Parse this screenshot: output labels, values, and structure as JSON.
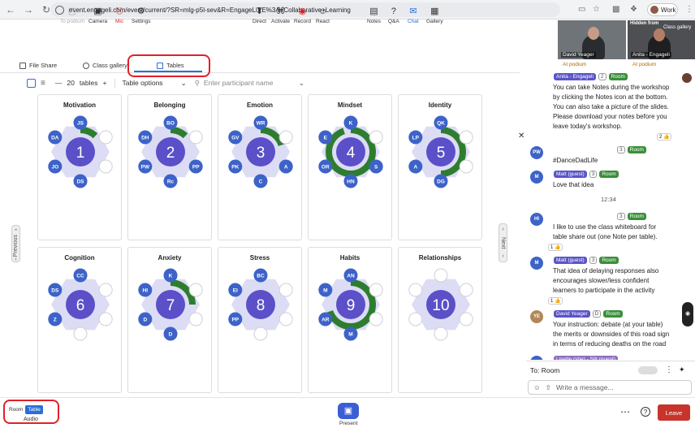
{
  "browser": {
    "url": "event.engageli.com/event/current/?SR=mlg-p5l-sev&R=EngageLIVE%3A+Collaborative+Learning",
    "profile": "Work"
  },
  "videos": [
    {
      "name": "David Yeager",
      "status": "At podium"
    },
    {
      "name": "Anita - Engageli",
      "status": "At podium",
      "overlay_left": "Hidden from",
      "overlay_right": "Class gallery"
    }
  ],
  "tabs": {
    "file_share": "File Share",
    "class_gallery": "Class gallery",
    "tables": "Tables"
  },
  "toolbar": {
    "count": "20",
    "count_label": "tables",
    "minus": "—",
    "plus": "+",
    "options": "Table options",
    "search_placeholder": "Enter participant name"
  },
  "tables": [
    {
      "title": "Motivation",
      "number": "1",
      "fill": 0.12,
      "seats": [
        "JS",
        "",
        "",
        "DS",
        "JO",
        "DA"
      ]
    },
    {
      "title": "Belonging",
      "number": "2",
      "fill": 0.12,
      "seats": [
        "BO",
        "",
        "PP",
        "Rc",
        "PW",
        "DH"
      ]
    },
    {
      "title": "Emotion",
      "number": "3",
      "fill": 0.2,
      "seats": [
        "WR",
        "",
        "A",
        "C",
        "PK",
        "GV"
      ]
    },
    {
      "title": "Mindset",
      "number": "4",
      "fill": 0.95,
      "seats": [
        "K",
        "",
        "S",
        "HN",
        "OR",
        "E"
      ]
    },
    {
      "title": "Identity",
      "number": "5",
      "fill": 0.5,
      "seats": [
        "QK",
        "",
        "",
        "DG",
        "A",
        "LP"
      ]
    },
    {
      "title": "Cognition",
      "number": "6",
      "fill": 0,
      "seats": [
        "CC",
        "",
        "",
        "",
        "Z",
        "DS"
      ]
    },
    {
      "title": "Anxiety",
      "number": "7",
      "fill": 0.25,
      "seats": [
        "K",
        "",
        "",
        "D",
        "D",
        "HI"
      ]
    },
    {
      "title": "Stress",
      "number": "8",
      "fill": 0,
      "seats": [
        "BC",
        "",
        "",
        "",
        "PP",
        "EI"
      ]
    },
    {
      "title": "Habits",
      "number": "9",
      "fill": 0.7,
      "seats": [
        "AN",
        "",
        "",
        "M",
        "AR",
        "M"
      ]
    },
    {
      "title": "Relationships",
      "number": "10",
      "fill": 0,
      "seats": [
        "",
        "",
        "",
        "",
        "",
        ""
      ]
    }
  ],
  "nav": {
    "previous": "Previous",
    "next": "Next"
  },
  "chat": {
    "messages": [
      {
        "initials": "",
        "author": "Anita - Engageli",
        "badge": "2",
        "room": "Room",
        "text": [
          "You can take Notes during the workshop",
          "by clicking the Notes icon at the bottom.",
          "You can also take a picture of the slides.",
          "Please download your notes before you",
          "leave today's workshop."
        ],
        "reaction": "2 👍"
      },
      {
        "initials": "PW",
        "author": "",
        "badge": "3",
        "room": "Room",
        "text": [
          "#DanceDadLife"
        ],
        "reaction": ""
      },
      {
        "initials": "M",
        "author": "Matt (guest)",
        "badge": "3",
        "room": "Room",
        "text": [
          "Love that idea"
        ],
        "reaction": ""
      },
      {
        "initials": "HI",
        "author": "",
        "badge": "3",
        "room": "Room",
        "text": [
          "I like to use the class whiteboard for",
          "table share out (one Note per table)."
        ],
        "reaction": "1 👍"
      },
      {
        "initials": "M",
        "author": "Matt (guest)",
        "badge": "3",
        "room": "Room",
        "text": [
          "That idea of delaying responses also",
          "encourages slower/less confident",
          "learners to participate in the activity"
        ],
        "reaction": "1 👍"
      },
      {
        "initials": "YE",
        "author": "David Yeager",
        "badge": "D",
        "room": "Room",
        "text": [
          "Your instruction: debate (at your table)",
          "the merits or downsides of this road sign",
          "in terms of reducing deaths on the road"
        ],
        "reaction": ""
      },
      {
        "initials": "LP",
        "author": "Lisette (she) - Sitt (guest)",
        "badge": "",
        "room": "",
        "text": [],
        "reaction": ""
      }
    ],
    "time": "12:34",
    "to": "To: Room",
    "placeholder": "Write a message..."
  },
  "bottom": {
    "audio_room": "Room",
    "audio_table": "Table",
    "audio": "Audio",
    "podium": "To podium",
    "camera": "Camera",
    "mic": "Mic",
    "settings": "Settings",
    "direct": "Direct",
    "activate": "Activate",
    "record": "Record",
    "react": "React",
    "present": "Present",
    "notes": "Notes",
    "qa": "Q&A",
    "chat": "Chat",
    "gallery": "Gallery",
    "leave": "Leave"
  },
  "colors": {
    "table": "#5b50c8",
    "seat": "#3d63c9",
    "fill": "#2e7d2e",
    "ring": "#dcdcf5",
    "accent": "#2b6fd6",
    "leave": "#c8342b"
  }
}
